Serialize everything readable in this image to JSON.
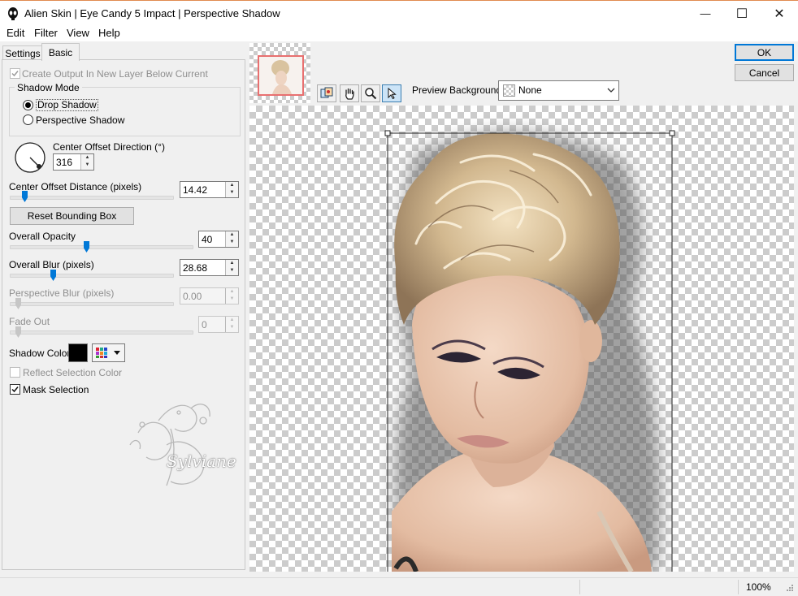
{
  "window": {
    "title": "Alien Skin | Eye Candy 5 Impact | Perspective Shadow",
    "minimize_glyph": "—",
    "maximize_glyph": "☐",
    "close_glyph": "✕"
  },
  "menu": {
    "edit": "Edit",
    "filter": "Filter",
    "view": "View",
    "help": "Help"
  },
  "tabs": {
    "settings": "Settings",
    "basic": "Basic"
  },
  "basic": {
    "create_output": "Create Output In New Layer Below Current",
    "shadow_mode_label": "Shadow Mode",
    "drop_shadow": "Drop Shadow",
    "perspective_shadow": "Perspective Shadow",
    "selected_mode": "Drop Shadow",
    "center_offset_direction_label": "Center Offset Direction (°)",
    "center_offset_direction_value": "316",
    "center_offset_distance_label": "Center Offset Distance (pixels)",
    "center_offset_distance_value": "14.42",
    "center_offset_distance_fraction": 0.09,
    "reset_bounding_box": "Reset Bounding Box",
    "overall_opacity_label": "Overall Opacity",
    "overall_opacity_value": "40",
    "overall_opacity_fraction": 0.4,
    "overall_blur_label": "Overall Blur (pixels)",
    "overall_blur_value": "28.68",
    "overall_blur_fraction": 0.28,
    "perspective_blur_label": "Perspective Blur (pixels)",
    "perspective_blur_value": "0.00",
    "fade_out_label": "Fade Out",
    "fade_out_value": "0",
    "shadow_color_label": "Shadow Color",
    "shadow_color": "#000000",
    "reflect_selection_color": "Reflect Selection Color",
    "mask_selection": "Mask Selection",
    "watermark_text": "Sylviane"
  },
  "actions": {
    "ok": "OK",
    "cancel": "Cancel"
  },
  "preview": {
    "background_label": "Preview Background:",
    "background_value": "None"
  },
  "status": {
    "zoom": "100%"
  },
  "colors": {
    "accent": "#0078d7",
    "thumbnail_frame": "#e87070"
  }
}
